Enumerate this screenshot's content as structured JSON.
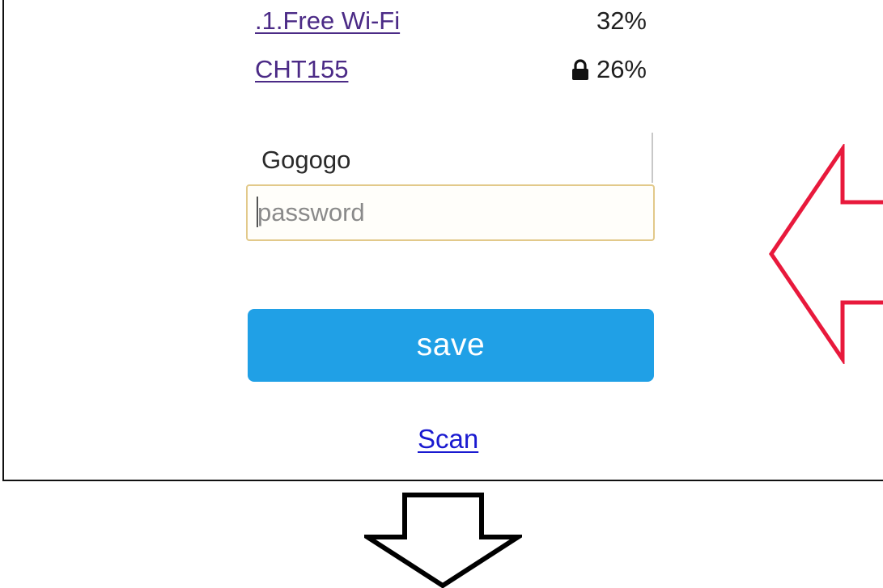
{
  "networks": [
    {
      "name": ".1.Free Wi-Fi",
      "signal": "32%",
      "locked": false,
      "lock_icon": ""
    },
    {
      "name": "CHT155",
      "signal": "26%",
      "locked": true,
      "lock_icon": "lock-icon"
    }
  ],
  "form": {
    "ssid_value": "Gogogo",
    "password_value": "",
    "password_placeholder": "password",
    "save_label": "save"
  },
  "scan_label": "Scan",
  "annotations": {
    "left_arrow_icon": "arrow-left-outline-icon",
    "left_arrow_color": "#e8193c",
    "down_arrow_icon": "arrow-down-outline-icon",
    "down_arrow_color": "#000000"
  },
  "colors": {
    "link_visited": "#4b2a86",
    "link": "#1a1ad0",
    "button": "#20a0e6",
    "input_border": "#e2c98a"
  }
}
